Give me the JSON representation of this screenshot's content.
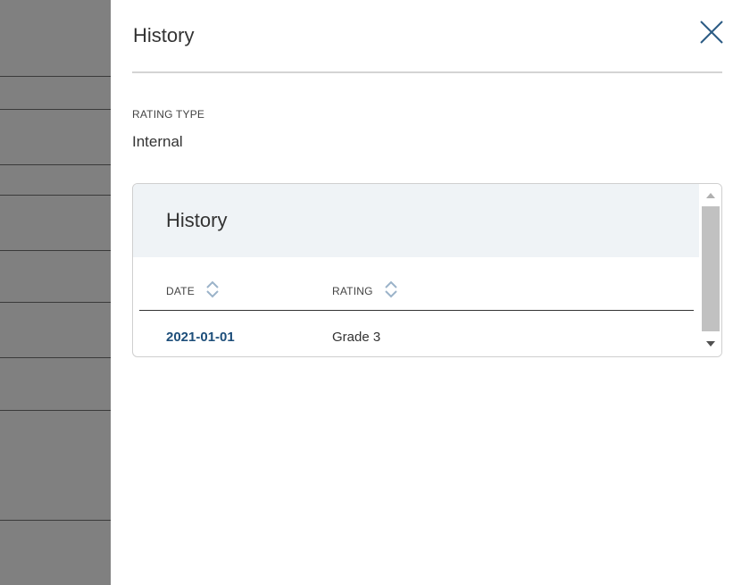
{
  "drawer": {
    "title": "History",
    "close_icon": "close-icon"
  },
  "rating_type": {
    "label": "RATING TYPE",
    "value": "Internal"
  },
  "history_card": {
    "title": "History",
    "columns": [
      {
        "label": "DATE",
        "sort_icon": "sort-icon"
      },
      {
        "label": "RATING",
        "sort_icon": "sort-icon"
      }
    ],
    "rows": [
      {
        "date": "2021-01-01",
        "rating": "Grade 3"
      }
    ]
  },
  "colors": {
    "accent": "#1d4e7a",
    "header_bg": "#eff3f6",
    "backdrop": "#808080"
  }
}
